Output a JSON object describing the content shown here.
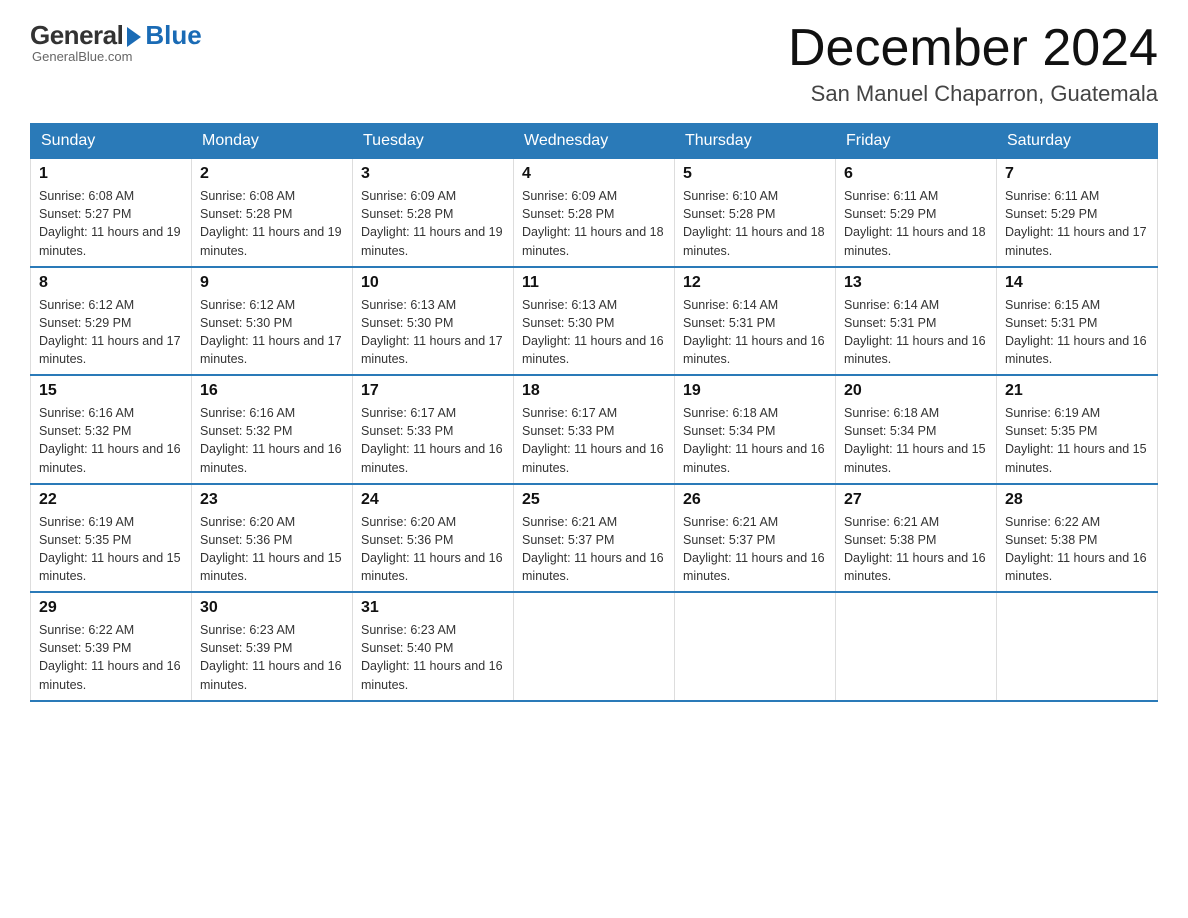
{
  "logo": {
    "general": "General",
    "blue": "Blue",
    "tagline": "GeneralBlue.com"
  },
  "header": {
    "month": "December 2024",
    "location": "San Manuel Chaparron, Guatemala"
  },
  "weekdays": [
    "Sunday",
    "Monday",
    "Tuesday",
    "Wednesday",
    "Thursday",
    "Friday",
    "Saturday"
  ],
  "weeks": [
    [
      {
        "day": "1",
        "sunrise": "6:08 AM",
        "sunset": "5:27 PM",
        "daylight": "11 hours and 19 minutes."
      },
      {
        "day": "2",
        "sunrise": "6:08 AM",
        "sunset": "5:28 PM",
        "daylight": "11 hours and 19 minutes."
      },
      {
        "day": "3",
        "sunrise": "6:09 AM",
        "sunset": "5:28 PM",
        "daylight": "11 hours and 19 minutes."
      },
      {
        "day": "4",
        "sunrise": "6:09 AM",
        "sunset": "5:28 PM",
        "daylight": "11 hours and 18 minutes."
      },
      {
        "day": "5",
        "sunrise": "6:10 AM",
        "sunset": "5:28 PM",
        "daylight": "11 hours and 18 minutes."
      },
      {
        "day": "6",
        "sunrise": "6:11 AM",
        "sunset": "5:29 PM",
        "daylight": "11 hours and 18 minutes."
      },
      {
        "day": "7",
        "sunrise": "6:11 AM",
        "sunset": "5:29 PM",
        "daylight": "11 hours and 17 minutes."
      }
    ],
    [
      {
        "day": "8",
        "sunrise": "6:12 AM",
        "sunset": "5:29 PM",
        "daylight": "11 hours and 17 minutes."
      },
      {
        "day": "9",
        "sunrise": "6:12 AM",
        "sunset": "5:30 PM",
        "daylight": "11 hours and 17 minutes."
      },
      {
        "day": "10",
        "sunrise": "6:13 AM",
        "sunset": "5:30 PM",
        "daylight": "11 hours and 17 minutes."
      },
      {
        "day": "11",
        "sunrise": "6:13 AM",
        "sunset": "5:30 PM",
        "daylight": "11 hours and 16 minutes."
      },
      {
        "day": "12",
        "sunrise": "6:14 AM",
        "sunset": "5:31 PM",
        "daylight": "11 hours and 16 minutes."
      },
      {
        "day": "13",
        "sunrise": "6:14 AM",
        "sunset": "5:31 PM",
        "daylight": "11 hours and 16 minutes."
      },
      {
        "day": "14",
        "sunrise": "6:15 AM",
        "sunset": "5:31 PM",
        "daylight": "11 hours and 16 minutes."
      }
    ],
    [
      {
        "day": "15",
        "sunrise": "6:16 AM",
        "sunset": "5:32 PM",
        "daylight": "11 hours and 16 minutes."
      },
      {
        "day": "16",
        "sunrise": "6:16 AM",
        "sunset": "5:32 PM",
        "daylight": "11 hours and 16 minutes."
      },
      {
        "day": "17",
        "sunrise": "6:17 AM",
        "sunset": "5:33 PM",
        "daylight": "11 hours and 16 minutes."
      },
      {
        "day": "18",
        "sunrise": "6:17 AM",
        "sunset": "5:33 PM",
        "daylight": "11 hours and 16 minutes."
      },
      {
        "day": "19",
        "sunrise": "6:18 AM",
        "sunset": "5:34 PM",
        "daylight": "11 hours and 16 minutes."
      },
      {
        "day": "20",
        "sunrise": "6:18 AM",
        "sunset": "5:34 PM",
        "daylight": "11 hours and 15 minutes."
      },
      {
        "day": "21",
        "sunrise": "6:19 AM",
        "sunset": "5:35 PM",
        "daylight": "11 hours and 15 minutes."
      }
    ],
    [
      {
        "day": "22",
        "sunrise": "6:19 AM",
        "sunset": "5:35 PM",
        "daylight": "11 hours and 15 minutes."
      },
      {
        "day": "23",
        "sunrise": "6:20 AM",
        "sunset": "5:36 PM",
        "daylight": "11 hours and 15 minutes."
      },
      {
        "day": "24",
        "sunrise": "6:20 AM",
        "sunset": "5:36 PM",
        "daylight": "11 hours and 16 minutes."
      },
      {
        "day": "25",
        "sunrise": "6:21 AM",
        "sunset": "5:37 PM",
        "daylight": "11 hours and 16 minutes."
      },
      {
        "day": "26",
        "sunrise": "6:21 AM",
        "sunset": "5:37 PM",
        "daylight": "11 hours and 16 minutes."
      },
      {
        "day": "27",
        "sunrise": "6:21 AM",
        "sunset": "5:38 PM",
        "daylight": "11 hours and 16 minutes."
      },
      {
        "day": "28",
        "sunrise": "6:22 AM",
        "sunset": "5:38 PM",
        "daylight": "11 hours and 16 minutes."
      }
    ],
    [
      {
        "day": "29",
        "sunrise": "6:22 AM",
        "sunset": "5:39 PM",
        "daylight": "11 hours and 16 minutes."
      },
      {
        "day": "30",
        "sunrise": "6:23 AM",
        "sunset": "5:39 PM",
        "daylight": "11 hours and 16 minutes."
      },
      {
        "day": "31",
        "sunrise": "6:23 AM",
        "sunset": "5:40 PM",
        "daylight": "11 hours and 16 minutes."
      },
      null,
      null,
      null,
      null
    ]
  ]
}
